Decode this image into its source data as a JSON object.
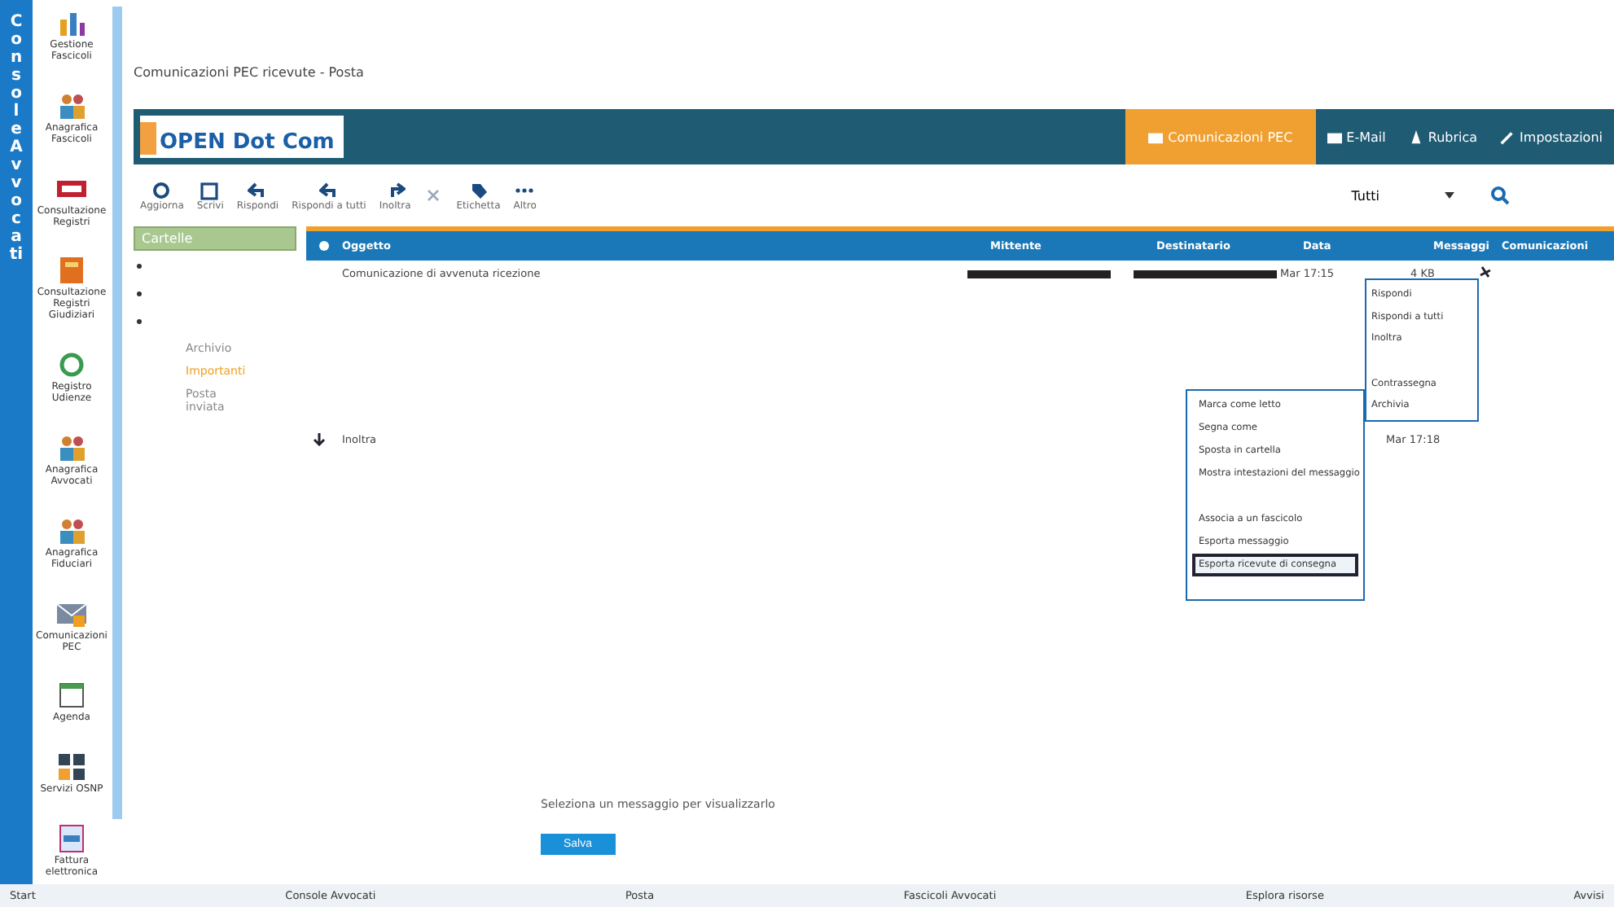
{
  "side_strip": {
    "label": "Console Avvocati"
  },
  "launcher": [
    {
      "label": "Gestione Fascicoli"
    },
    {
      "label": "Anagrafica Fascicoli"
    },
    {
      "label": "Consultazione Registri"
    },
    {
      "label": "Consultazione Registri Giudiziari"
    },
    {
      "label": "Registro Udienze"
    },
    {
      "label": "Anagrafica Avvocati"
    },
    {
      "label": "Anagrafica Fiduciari"
    },
    {
      "label": "Comunicazioni PEC"
    },
    {
      "label": "Agenda"
    },
    {
      "label": "Servizi OSNP"
    },
    {
      "label": "Fattura elettronica"
    }
  ],
  "breadcrumb": "Comunicazioni PEC ricevute - Posta",
  "header": {
    "logo": "OPEN Dot Com",
    "tabs": [
      {
        "label": "Comunicazioni PEC",
        "selected": true
      },
      {
        "label": "E-Mail",
        "selected": false
      },
      {
        "label": "Rubrica",
        "selected": false
      },
      {
        "label": "Impostazioni",
        "selected": false
      }
    ]
  },
  "toolbar": [
    {
      "kind": "labeled",
      "label": "Aggiorna"
    },
    {
      "kind": "labeled",
      "label": "Scrivi"
    },
    {
      "kind": "labeled",
      "label": "Rispondi"
    },
    {
      "kind": "labeled",
      "label": "Rispondi a tutti"
    },
    {
      "kind": "labeled",
      "label": "Inoltra"
    },
    {
      "kind": "icon"
    },
    {
      "kind": "labeled",
      "label": "Etichetta"
    },
    {
      "kind": "labeled",
      "label": "Altro"
    }
  ],
  "filter": {
    "value": "Tutti"
  },
  "folders": {
    "title": "Cartelle",
    "items": [
      {
        "label": "Archivio",
        "color": "#8a8a8a"
      },
      {
        "label": "Importanti",
        "color": "#f0a020"
      },
      {
        "label": "Posta inviata",
        "color": "#8a8a8a"
      }
    ]
  },
  "table": {
    "columns": [
      "Oggetto",
      "Mittente",
      "Destinatario",
      "Data",
      "Messaggi",
      "Comunicazioni"
    ],
    "rows": [
      {
        "subject": "Comunicazione di avvenuta ricezione",
        "date": "Mar 17:15",
        "size": "4 KB"
      }
    ]
  },
  "menu_row": {
    "label": "Inoltra",
    "date": "Mar 17:18"
  },
  "context_menu": [
    {
      "kind": "item",
      "label": "Rispondi"
    },
    {
      "kind": "item",
      "label": "Rispondi a tutti"
    },
    {
      "kind": "item",
      "label": "Inoltra"
    },
    {
      "kind": "gap"
    },
    {
      "kind": "item",
      "label": "Contrassegna"
    },
    {
      "kind": "item",
      "label": "Archivia"
    }
  ],
  "submenu": [
    {
      "kind": "item",
      "label": "Marca come letto",
      "selected": false
    },
    {
      "kind": "item",
      "label": "Segna come",
      "selected": false
    },
    {
      "kind": "item",
      "label": "Sposta in cartella",
      "selected": false
    },
    {
      "kind": "item",
      "label": "Mostra intestazioni del messaggio",
      "selected": false
    },
    {
      "kind": "gap"
    },
    {
      "kind": "item",
      "label": "Associa a un fascicolo",
      "selected": false
    },
    {
      "kind": "item",
      "label": "Esporta messaggio",
      "selected": false
    },
    {
      "kind": "item",
      "label": "Esporta ricevute di consegna",
      "selected": true
    }
  ],
  "footer": {
    "note": "Seleziona un messaggio per visualizzarlo",
    "button": "Salva"
  },
  "taskbar": [
    "Start",
    "Console Avvocati",
    "Posta",
    "Fascicoli Avvocati",
    "Esplora risorse",
    "Avvisi"
  ]
}
